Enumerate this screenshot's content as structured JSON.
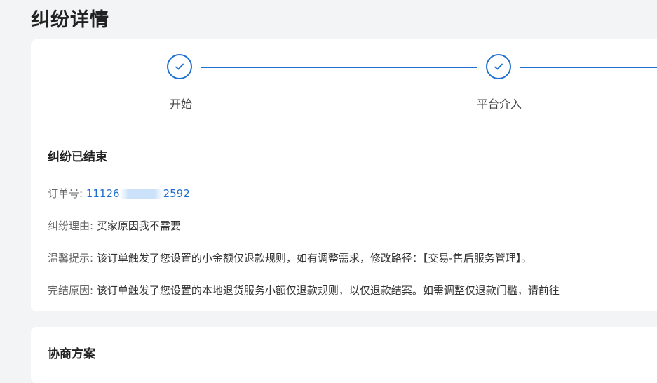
{
  "page": {
    "title": "纠纷详情"
  },
  "steps": [
    {
      "label": "开始",
      "status": "done",
      "icon": "check-icon"
    },
    {
      "label": "平台介入",
      "status": "done",
      "icon": "check-icon"
    }
  ],
  "status": {
    "title": "纠纷已结束"
  },
  "details": {
    "order": {
      "label": "订单号:",
      "value_prefix": "11126",
      "value_suffix": "2592"
    },
    "reason": {
      "label": "纠纷理由:",
      "value": "买家原因我不需要"
    },
    "tip": {
      "label": "温馨提示:",
      "value": "该订单触发了您设置的小金额仅退款规则，如有调整需求，修改路径：【交易-售后服务管理】。"
    },
    "close_reason": {
      "label": "完结原因:",
      "value": "该订单触发了您设置的本地退货服务小额仅退款规则，以仅退款结案。如需调整仅退款门槛，请前往"
    }
  },
  "negotiation": {
    "title": "协商方案"
  },
  "colors": {
    "accent": "#1f6fd1",
    "background": "#f3f4f6",
    "card": "#ffffff"
  }
}
